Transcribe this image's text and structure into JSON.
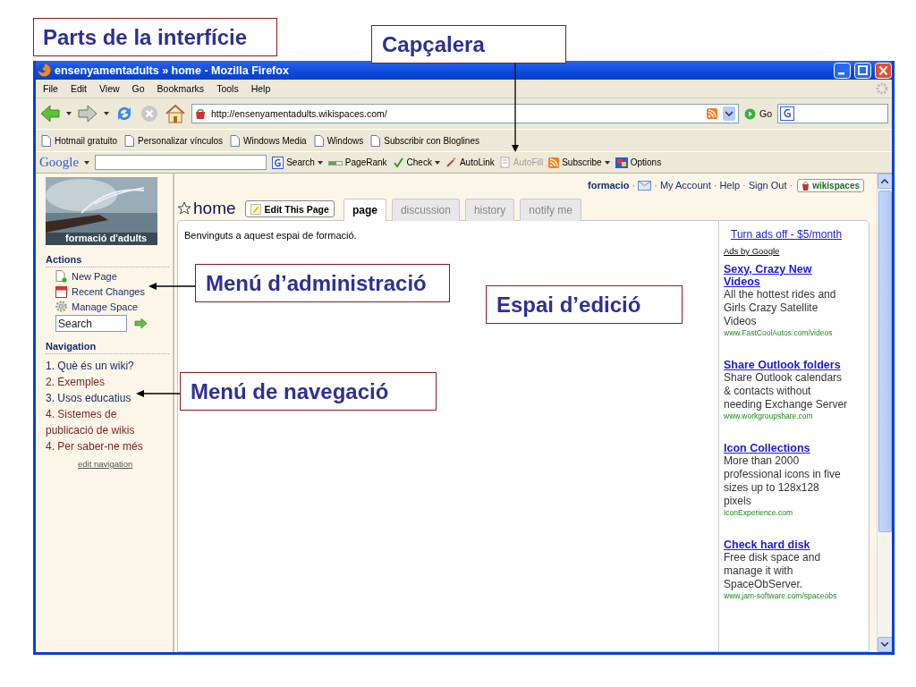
{
  "slide": {
    "title": "Parts de la interfície"
  },
  "callouts": [
    {
      "kind": "header",
      "text": "Capçalera"
    },
    {
      "kind": "admin",
      "text": "Menú d’administració"
    },
    {
      "kind": "edit",
      "text": "Espai d’edició"
    },
    {
      "kind": "nav",
      "text": "Menú de navegació"
    }
  ],
  "window": {
    "title": "ensenyamentadults » home - Mozilla Firefox"
  },
  "menu": [
    "File",
    "Edit",
    "View",
    "Go",
    "Bookmarks",
    "Tools",
    "Help"
  ],
  "nav_bar": {
    "url": "http://ensenyamentadults.wikispaces.com/",
    "go": "Go"
  },
  "bookmarks": [
    "Hotmail gratuito",
    "Personalizar vínculos",
    "Windows Media",
    "Windows",
    "Subscribir con Bloglines"
  ],
  "google_toolbar": {
    "logo": "Google",
    "items": [
      {
        "label": "Search",
        "dropdown": true,
        "disabled": false
      },
      {
        "label": "PageRank",
        "dropdown": false,
        "disabled": false
      },
      {
        "label": "Check",
        "dropdown": true,
        "disabled": false
      },
      {
        "label": "AutoLink",
        "dropdown": false,
        "disabled": false
      },
      {
        "label": "AutoFill",
        "dropdown": false,
        "disabled": true
      },
      {
        "label": "Subscribe",
        "dropdown": true,
        "disabled": false
      },
      {
        "label": "Options",
        "dropdown": false,
        "disabled": false
      }
    ]
  },
  "user_bar": {
    "items": [
      {
        "kind": "user",
        "text": "formacio"
      },
      {
        "kind": "sep",
        "text": "·"
      },
      {
        "kind": "mail"
      },
      {
        "kind": "sep",
        "text": "·"
      },
      {
        "kind": "link",
        "text": "My Account"
      },
      {
        "kind": "sep",
        "text": "·"
      },
      {
        "kind": "link",
        "text": "Help"
      },
      {
        "kind": "sep",
        "text": "·"
      },
      {
        "kind": "link",
        "text": "Sign Out"
      },
      {
        "kind": "sep",
        "text": "·"
      },
      {
        "kind": "badge",
        "text": "wikispaces"
      }
    ]
  },
  "sidebar": {
    "logo_caption": "formació d'adults",
    "actions_title": "Actions",
    "actions": [
      "New Page",
      "Recent Changes",
      "Manage Space"
    ],
    "search_placeholder": "Search",
    "navigation_title": "Navigation",
    "navigation": [
      {
        "text": "1. Què és un wiki?",
        "visited": false
      },
      {
        "text": "2. Exemples",
        "visited": true
      },
      {
        "text": "3. Usos educatius",
        "visited": false
      },
      {
        "text": "4. Sistemes de publicació de wikis",
        "visited": true
      },
      {
        "text": "4. Per saber-ne més",
        "visited": true
      }
    ],
    "edit_link": "edit navigation"
  },
  "page": {
    "title": "home",
    "edit_button": "Edit This Page",
    "tabs": [
      {
        "label": "page",
        "selected": true
      },
      {
        "label": "discussion",
        "selected": false
      },
      {
        "label": "history",
        "selected": false
      },
      {
        "label": "notify me",
        "selected": false
      }
    ],
    "body": "Benvinguts a aquest espai de formació."
  },
  "ads": {
    "turn_off": "Turn ads off - $5/month",
    "by": "Ads by Google",
    "items": [
      {
        "title": "Sexy, Crazy New Videos",
        "text": "All the hottest rides and Girls Crazy Satellite Videos",
        "url": "www.FastCoolAutos.com/videos"
      },
      {
        "title": "Share Outlook folders",
        "text": "Share Outlook calendars & contacts without needing Exchange Server",
        "url": "www.workgroupshare.com"
      },
      {
        "title": "Icon Collections",
        "text": "More than 2000 professional icons in five sizes up to 128x128 pixels",
        "url": "IconExperience.com"
      },
      {
        "title": "Check hard disk",
        "text": "Free disk space and manage it with SpaceObServer.",
        "url": "www.jam-software.com/spaceobs"
      }
    ]
  }
}
